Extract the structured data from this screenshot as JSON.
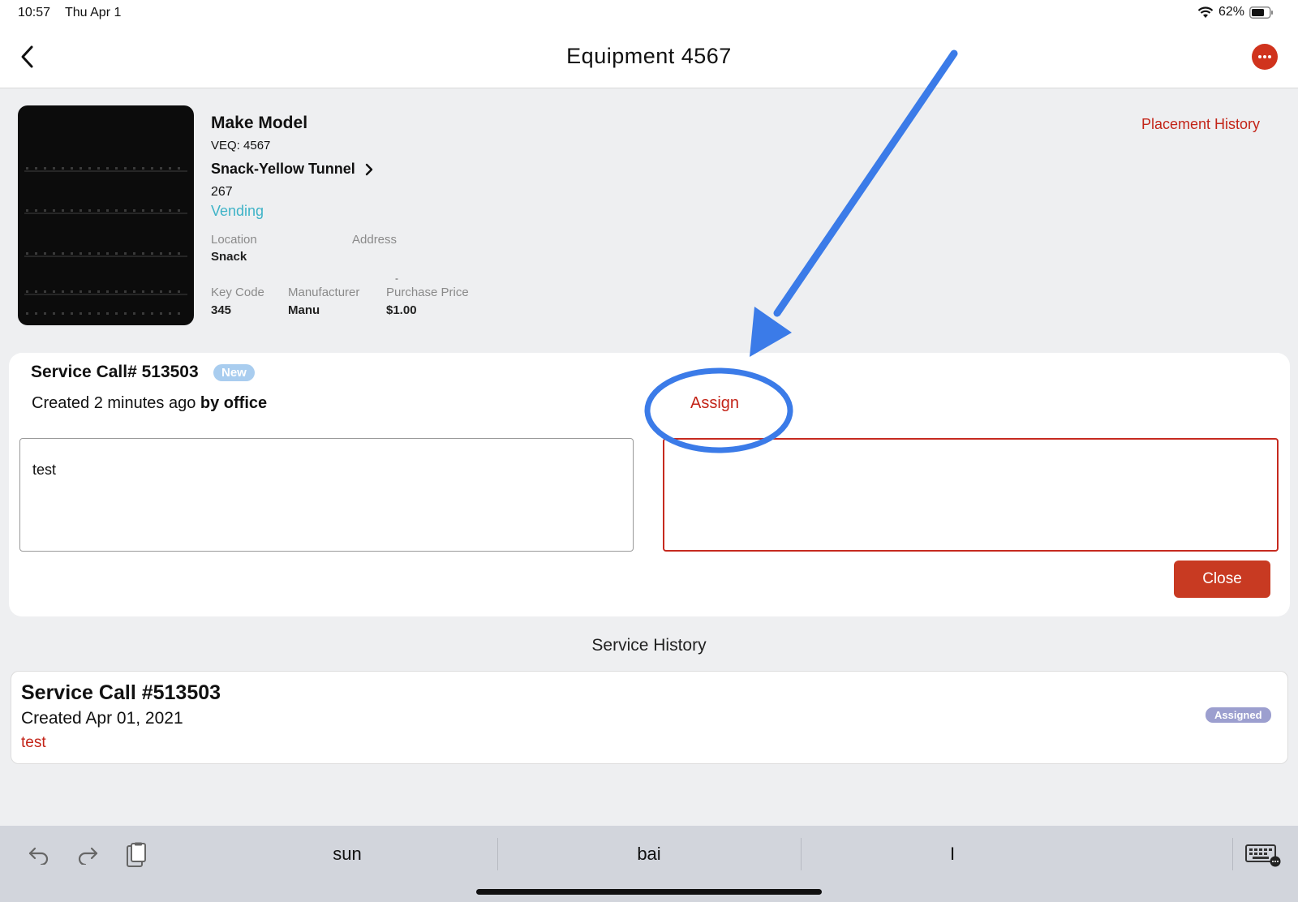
{
  "status_bar": {
    "time": "10:57",
    "date": "Thu Apr 1",
    "battery": "62%"
  },
  "nav": {
    "title": "Equipment 4567"
  },
  "equipment": {
    "make_model": "Make Model",
    "veq": "VEQ: 4567",
    "location_name": "Snack-Yellow Tunnel",
    "number": "267",
    "category": "Vending",
    "placement_history": "Placement History",
    "details": {
      "location_label": "Location",
      "location_value": "Snack",
      "address_label": "Address",
      "address_value": "",
      "key_code_label": "Key Code",
      "key_code_value": "345",
      "manufacturer_label": "Manufacturer",
      "manufacturer_value": "Manu",
      "purchase_price_label": "Purchase Price",
      "purchase_price_value": "$1.00",
      "dash": "-"
    }
  },
  "service_call": {
    "title": "Service Call# 513503",
    "badge": "New",
    "created_prefix": "Created 2 minutes ago ",
    "created_by": "by office",
    "assign_label": "Assign",
    "notes": "test",
    "close_label": "Close"
  },
  "service_history": {
    "title": "Service History",
    "items": [
      {
        "title": "Service Call #513503",
        "created": "Created  Apr 01, 2021",
        "note": "test",
        "status": "Assigned"
      }
    ]
  },
  "keyboard_bar": {
    "suggestions": [
      "sun",
      "bai",
      "I"
    ]
  },
  "colors": {
    "accent": "#c32418",
    "annotation": "#3b7be8",
    "vending": "#3eb3c7"
  }
}
